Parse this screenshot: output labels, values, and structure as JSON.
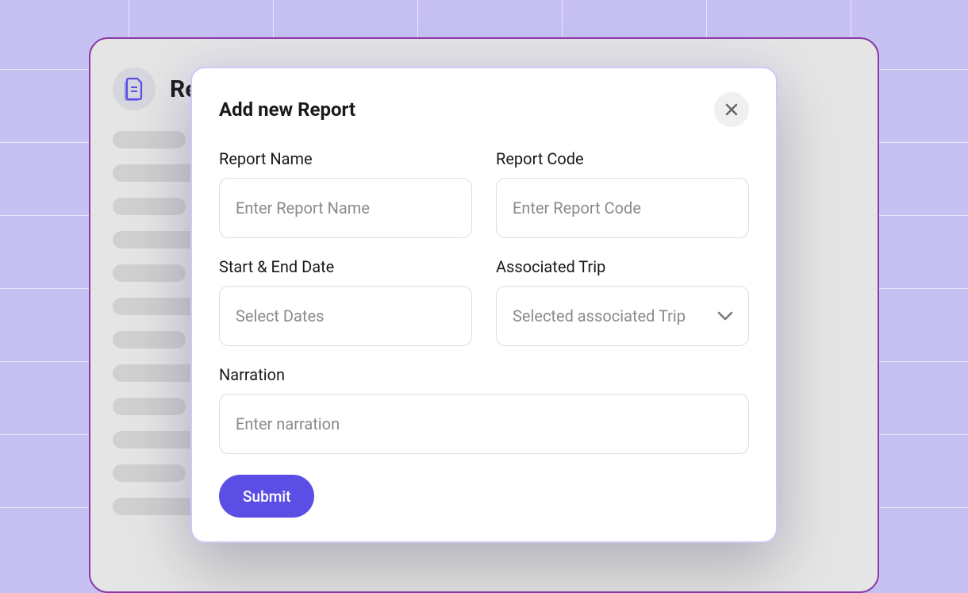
{
  "page": {
    "title": "Re",
    "icon": "document-icon"
  },
  "modal": {
    "title": "Add new Report",
    "fields": {
      "reportName": {
        "label": "Report Name",
        "placeholder": "Enter Report Name",
        "value": ""
      },
      "reportCode": {
        "label": "Report Code",
        "placeholder": "Enter Report Code",
        "value": ""
      },
      "dates": {
        "label": "Start & End Date",
        "placeholder": "Select Dates",
        "value": ""
      },
      "trip": {
        "label": "Associated Trip",
        "placeholder": "Selected associated Trip",
        "value": ""
      },
      "narration": {
        "label": "Narration",
        "placeholder": "Enter narration",
        "value": ""
      }
    },
    "submitLabel": "Submit"
  }
}
